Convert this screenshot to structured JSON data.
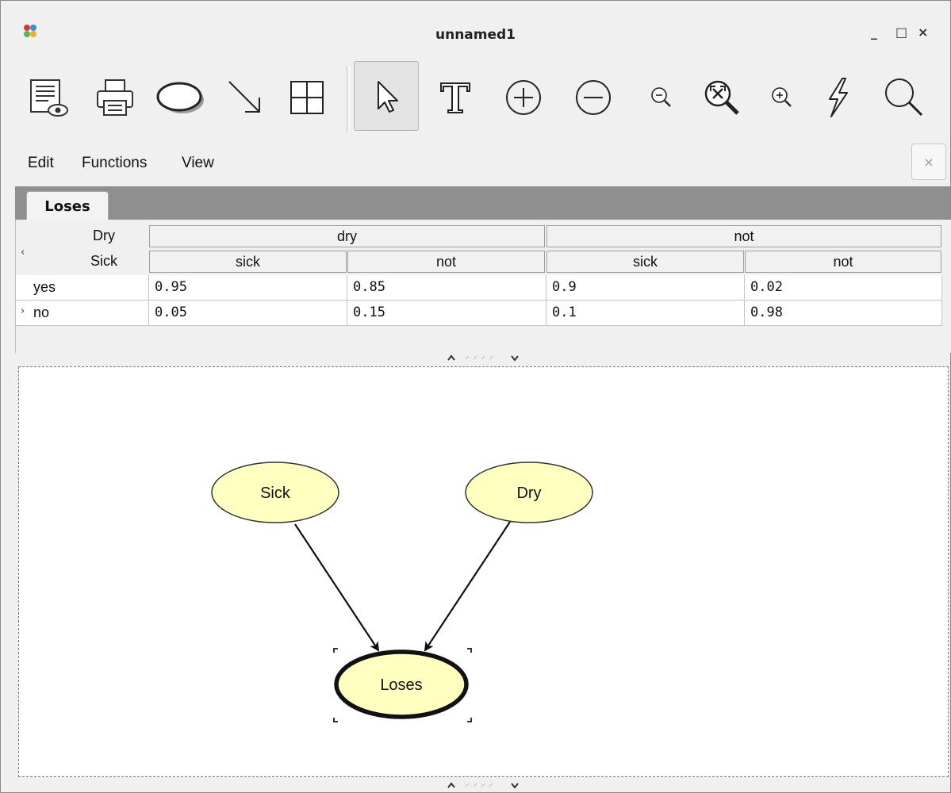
{
  "window": {
    "title": "unnamed1",
    "controls": {
      "minimize": "_",
      "maximize": "□",
      "close": "×"
    }
  },
  "toolbar": {
    "tools": [
      {
        "icon": "preview-icon"
      },
      {
        "icon": "print-icon"
      },
      {
        "icon": "ellipse-node-icon"
      },
      {
        "icon": "arrow-link-icon"
      },
      {
        "icon": "table-icon"
      },
      {
        "icon": "pointer-icon",
        "active": true
      },
      {
        "icon": "text-tool-icon"
      },
      {
        "icon": "add-icon"
      },
      {
        "icon": "remove-icon"
      },
      {
        "icon": "zoom-out-icon"
      },
      {
        "icon": "zoom-fit-icon"
      },
      {
        "icon": "zoom-in-icon"
      },
      {
        "icon": "lightning-icon"
      },
      {
        "icon": "search-icon"
      }
    ]
  },
  "menu": {
    "edit": "Edit",
    "functions": "Functions",
    "view": "View"
  },
  "panel": {
    "close_label": "×",
    "tab_label": "Loses"
  },
  "cpt": {
    "parent1_name": "Dry",
    "parent2_name": "Sick",
    "parent1_values": [
      "dry",
      "not"
    ],
    "parent2_values": [
      "sick",
      "not",
      "sick",
      "not"
    ],
    "rows": [
      {
        "label": "yes",
        "values": [
          "0.95",
          "0.85",
          "0.9",
          "0.02"
        ]
      },
      {
        "label": "no",
        "values": [
          "0.05",
          "0.15",
          "0.1",
          "0.98"
        ]
      }
    ]
  },
  "graph": {
    "nodes": {
      "sick": "Sick",
      "dry": "Dry",
      "loses": "Loses"
    },
    "colors": {
      "node_fill": "#ffffc0",
      "node_stroke": "#333333"
    }
  }
}
